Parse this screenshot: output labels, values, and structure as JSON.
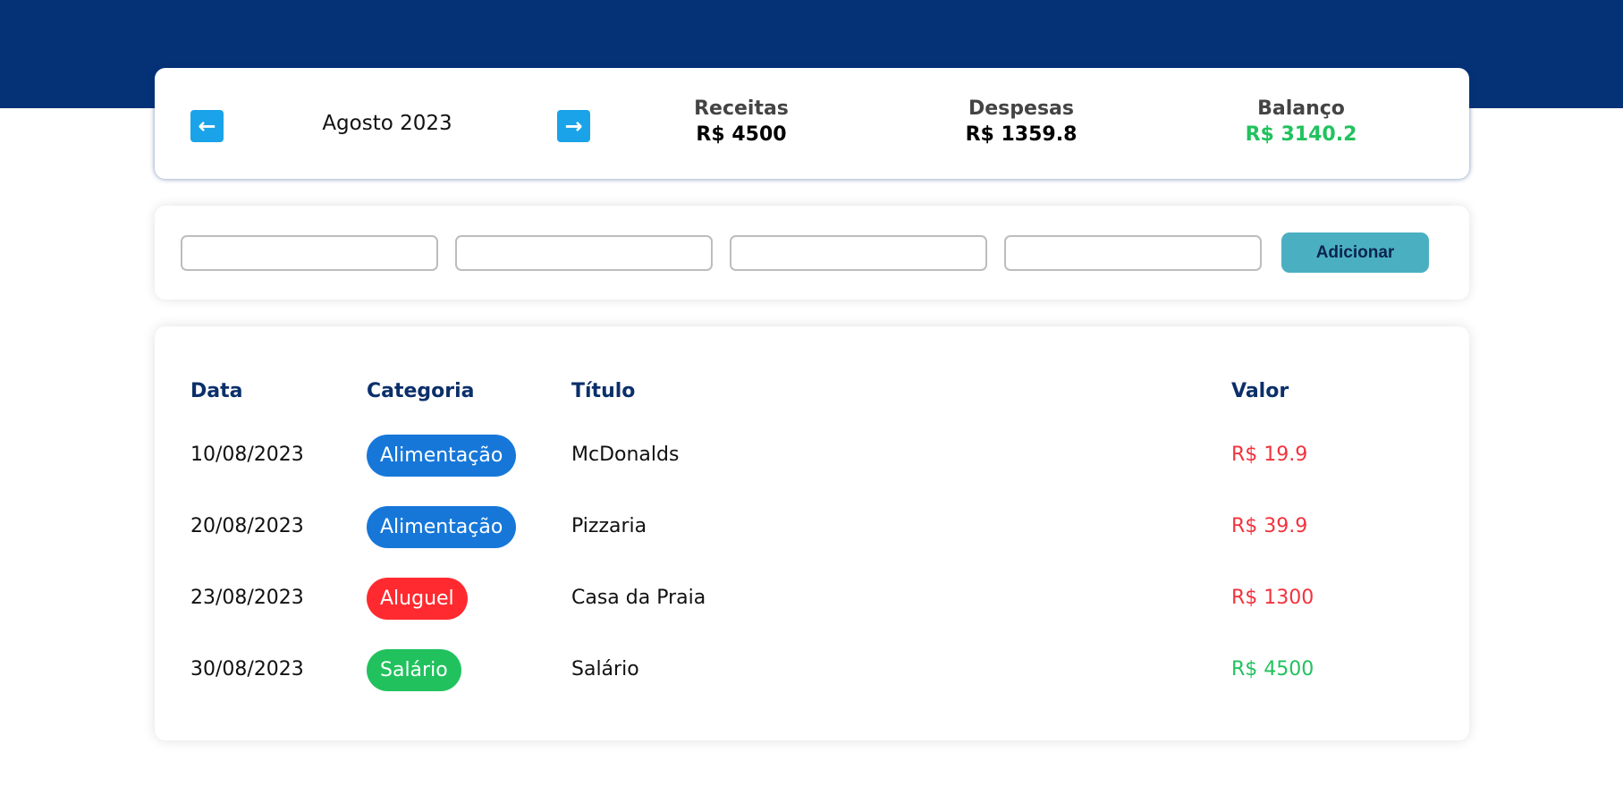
{
  "header": {
    "prev_icon": "arrow-left-icon",
    "next_icon": "arrow-right-icon",
    "month_label": "Agosto 2023"
  },
  "summary": {
    "receitas_label": "Receitas",
    "receitas_value": "R$ 4500",
    "despesas_label": "Despesas",
    "despesas_value": "R$ 1359.8",
    "balanco_label": "Balanço",
    "balanco_value": "R$ 3140.2",
    "balanco_color": "#21c25e"
  },
  "form": {
    "fields": [
      "",
      "",
      "",
      ""
    ],
    "add_label": "Adicionar"
  },
  "table": {
    "headers": {
      "data": "Data",
      "categoria": "Categoria",
      "titulo": "Título",
      "valor": "Valor"
    },
    "rows": [
      {
        "date": "10/08/2023",
        "category": "Alimentação",
        "category_color": "#1677d9",
        "title": "McDonalds",
        "value": "R$ 19.9",
        "value_color": "#f2333d"
      },
      {
        "date": "20/08/2023",
        "category": "Alimentação",
        "category_color": "#1677d9",
        "title": "Pizzaria",
        "value": "R$ 39.9",
        "value_color": "#f2333d"
      },
      {
        "date": "23/08/2023",
        "category": "Aluguel",
        "category_color": "#ff2a2f",
        "title": "Casa da Praia",
        "value": "R$ 1300",
        "value_color": "#f2333d"
      },
      {
        "date": "30/08/2023",
        "category": "Salário",
        "category_color": "#21c25e",
        "title": "Salário",
        "value": "R$ 4500",
        "value_color": "#21c25e"
      }
    ]
  },
  "colors": {
    "topbar": "#053176",
    "arrow": "#1aa3e8",
    "add_button": "#4ab0c1"
  }
}
